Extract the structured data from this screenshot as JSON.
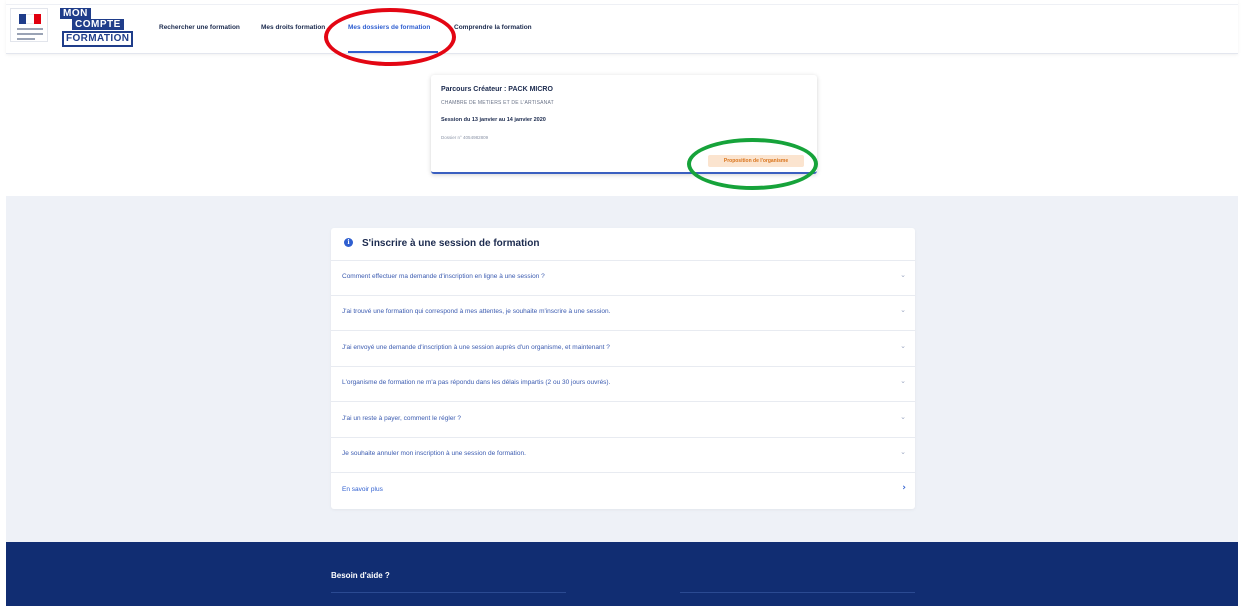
{
  "header": {
    "brand": {
      "line1": "MON",
      "line2": "COMPTE",
      "line3": "FORMATION"
    },
    "nav": [
      {
        "label": "Rechercher une formation",
        "active": false
      },
      {
        "label": "Mes droits formation",
        "active": false
      },
      {
        "label": "Mes dossiers de formation",
        "active": true
      },
      {
        "label": "Comprendre la formation",
        "active": false
      }
    ]
  },
  "dossier_card": {
    "title": "Parcours Créateur : PACK MICRO",
    "organisme": "CHAMBRE DE METIERS ET DE L'ARTISANAT",
    "session": "Session du 13 janvier au 14 janvier 2020",
    "dossier": "Dossier n° 4054982809",
    "status_badge": "Proposition de l'organisme"
  },
  "faq": {
    "title": "S'inscrire à une session de formation",
    "items": [
      "Comment effectuer ma demande d'inscription en ligne à une session ?",
      "J'ai trouvé une formation qui correspond à mes attentes, je souhaite m'inscrire à une session.",
      "J'ai envoyé une demande d'inscription à une session auprès d'un organisme, et maintenant ?",
      "L'organisme de formation ne m'a pas répondu dans les délais impartis (2 ou 30 jours ouvrés).",
      "J'ai un reste à payer, comment le régler ?",
      "Je souhaite annuler mon inscription à une session de formation."
    ],
    "more": "En savoir plus"
  },
  "footer": {
    "help_title": "Besoin d'aide ?"
  },
  "colors": {
    "accent": "#2f5fd0",
    "navy": "#112d72",
    "badge_bg": "#fbe4cf",
    "badge_text": "#d9731a",
    "annotation_red": "#e30613",
    "annotation_green": "#16a33a"
  }
}
